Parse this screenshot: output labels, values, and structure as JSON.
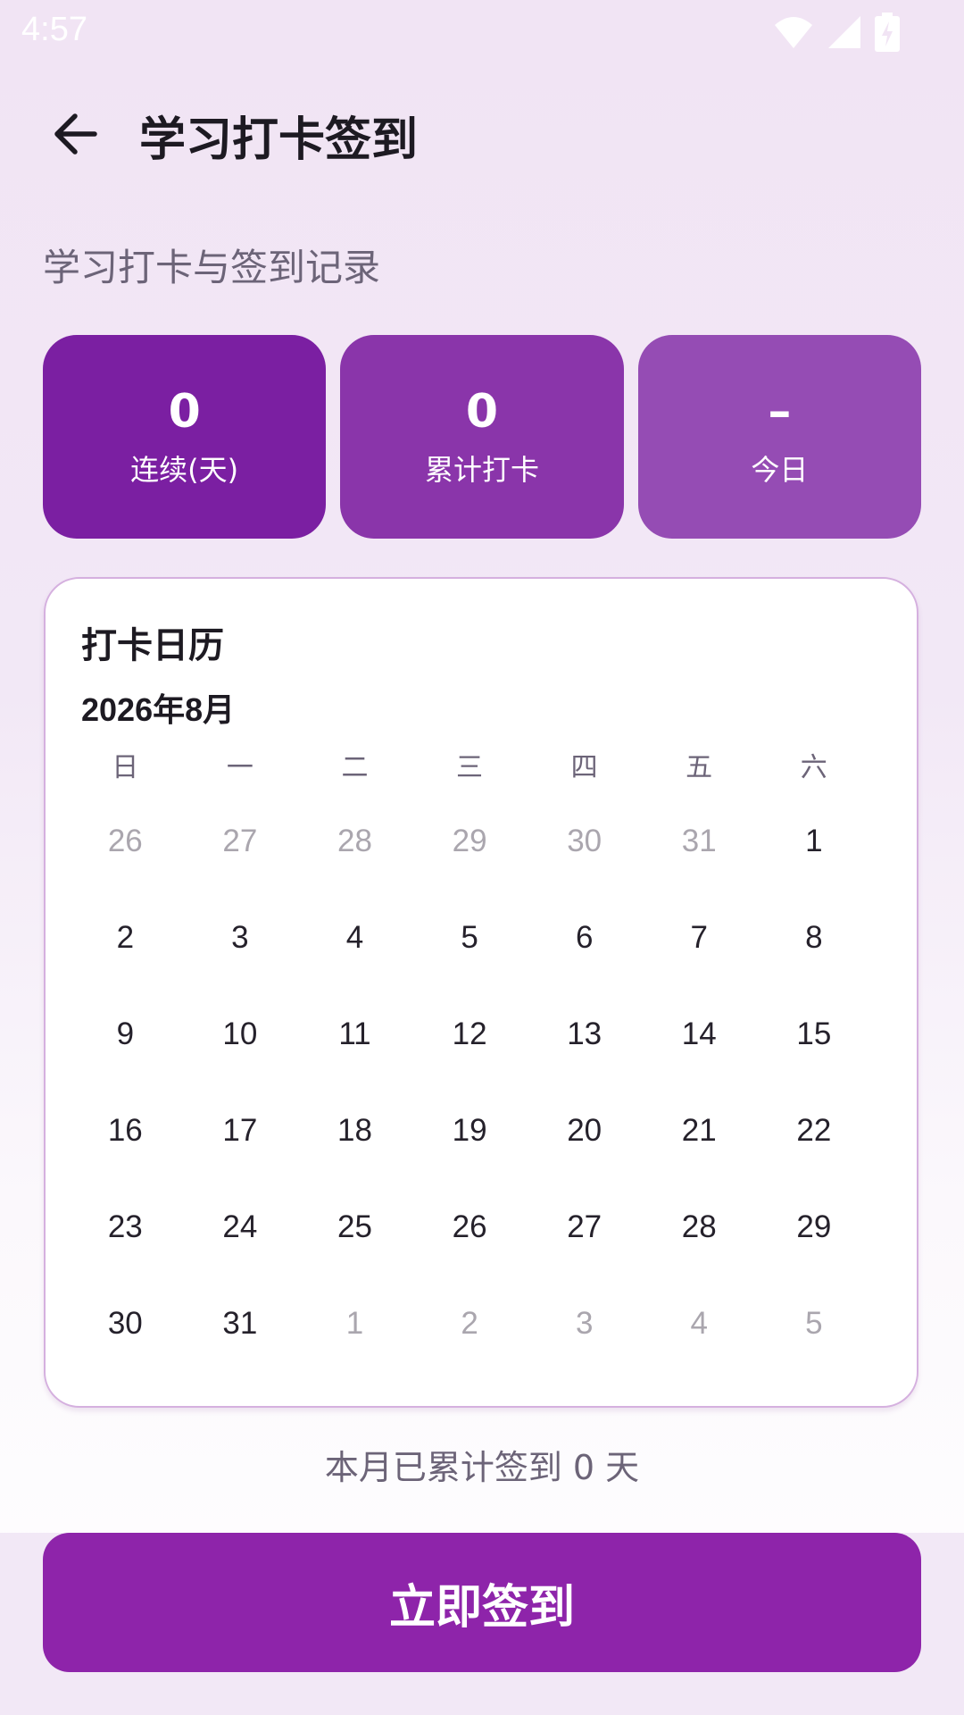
{
  "status_bar": {
    "time": "4:57",
    "icons": [
      "wifi-icon",
      "cellular-signal-icon",
      "battery-charging-icon"
    ]
  },
  "app_bar": {
    "back_icon": "arrow-back-icon",
    "title": "学习打卡签到"
  },
  "subtitle": "学习打卡与签到记录",
  "stats": [
    {
      "value": "0",
      "label": "连续(天)"
    },
    {
      "value": "0",
      "label": "累计打卡"
    },
    {
      "value": "–",
      "label": "今日"
    }
  ],
  "calendar": {
    "title": "打卡日历",
    "month": "2026年8月",
    "weekdays": [
      "日",
      "一",
      "二",
      "三",
      "四",
      "五",
      "六"
    ],
    "days": [
      {
        "label": "26",
        "in_month": false
      },
      {
        "label": "27",
        "in_month": false
      },
      {
        "label": "28",
        "in_month": false
      },
      {
        "label": "29",
        "in_month": false
      },
      {
        "label": "30",
        "in_month": false
      },
      {
        "label": "31",
        "in_month": false
      },
      {
        "label": "1",
        "in_month": true
      },
      {
        "label": "2",
        "in_month": true
      },
      {
        "label": "3",
        "in_month": true
      },
      {
        "label": "4",
        "in_month": true
      },
      {
        "label": "5",
        "in_month": true
      },
      {
        "label": "6",
        "in_month": true
      },
      {
        "label": "7",
        "in_month": true
      },
      {
        "label": "8",
        "in_month": true
      },
      {
        "label": "9",
        "in_month": true
      },
      {
        "label": "10",
        "in_month": true
      },
      {
        "label": "11",
        "in_month": true
      },
      {
        "label": "12",
        "in_month": true
      },
      {
        "label": "13",
        "in_month": true
      },
      {
        "label": "14",
        "in_month": true
      },
      {
        "label": "15",
        "in_month": true
      },
      {
        "label": "16",
        "in_month": true
      },
      {
        "label": "17",
        "in_month": true
      },
      {
        "label": "18",
        "in_month": true
      },
      {
        "label": "19",
        "in_month": true
      },
      {
        "label": "20",
        "in_month": true
      },
      {
        "label": "21",
        "in_month": true
      },
      {
        "label": "22",
        "in_month": true
      },
      {
        "label": "23",
        "in_month": true
      },
      {
        "label": "24",
        "in_month": true
      },
      {
        "label": "25",
        "in_month": true
      },
      {
        "label": "26",
        "in_month": true
      },
      {
        "label": "27",
        "in_month": true
      },
      {
        "label": "28",
        "in_month": true
      },
      {
        "label": "29",
        "in_month": true
      },
      {
        "label": "30",
        "in_month": true
      },
      {
        "label": "31",
        "in_month": true
      },
      {
        "label": "1",
        "in_month": false
      },
      {
        "label": "2",
        "in_month": false
      },
      {
        "label": "3",
        "in_month": false
      },
      {
        "label": "4",
        "in_month": false
      },
      {
        "label": "5",
        "in_month": false
      }
    ]
  },
  "month_summary": "本月已累计签到 0 天",
  "checkin_button": "立即签到",
  "colors": {
    "primary": "#8e24aa",
    "tile_1": "#7b1fa2",
    "tile_2": "#8a35aa",
    "tile_3": "#954cb4",
    "background": "#f2e8f6"
  }
}
